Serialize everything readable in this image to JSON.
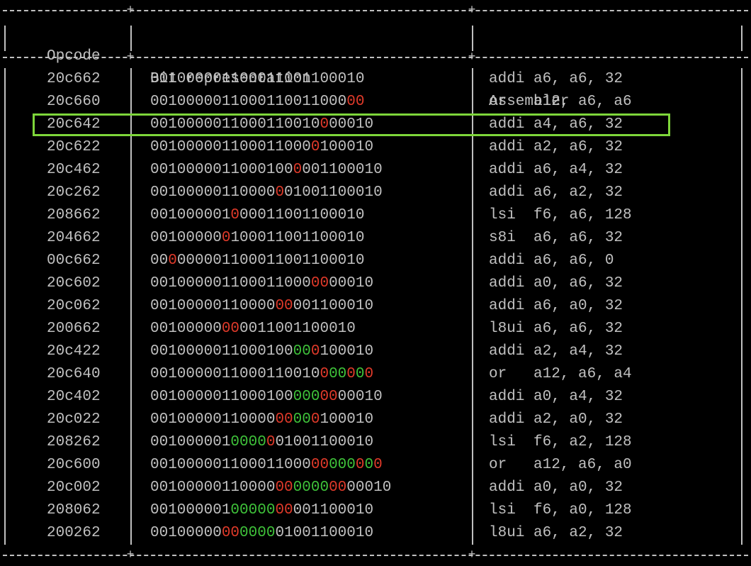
{
  "colors": {
    "background": "#000000",
    "text": "#c0c0c0",
    "changed_bit": "#e03a2a",
    "unchanged_marked_bit": "#3fc23a",
    "highlight": "#7ed63a"
  },
  "headers": {
    "opcode": "Opcode",
    "bits": "Bit representation",
    "assembler": "Assembler"
  },
  "rows": [
    {
      "opcode": "20c662",
      "bits": [
        [
          "001000001100011001100010",
          ""
        ]
      ],
      "asm": "addi a6, a6, 32"
    },
    {
      "opcode": "20c660",
      "bits": [
        [
          "0010000011000110011000",
          ""
        ],
        [
          "00",
          "r"
        ]
      ],
      "asm": "or   a12, a6, a6"
    },
    {
      "opcode": "20c642",
      "bits": [
        [
          "0010000011000110010",
          ""
        ],
        [
          "0",
          "r"
        ],
        [
          "00010",
          ""
        ]
      ],
      "asm": "addi a4, a6, 32",
      "highlighted": true
    },
    {
      "opcode": "20c622",
      "bits": [
        [
          "001000001100011000",
          ""
        ],
        [
          "0",
          "r"
        ],
        [
          "100010",
          ""
        ]
      ],
      "asm": "addi a2, a6, 32"
    },
    {
      "opcode": "20c462",
      "bits": [
        [
          "0010000011000100",
          ""
        ],
        [
          "0",
          "r"
        ],
        [
          "0",
          ""
        ],
        [
          "01100010",
          ""
        ]
      ],
      "asm": "addi a6, a4, 32"
    },
    {
      "opcode": "20c262",
      "bits": [
        [
          "00100000110000",
          ""
        ],
        [
          "0",
          "r"
        ],
        [
          "01001100010",
          ""
        ]
      ],
      "asm": "addi a6, a2, 32"
    },
    {
      "opcode": "208662",
      "bits": [
        [
          "001000001",
          ""
        ],
        [
          "0",
          "r"
        ],
        [
          "00011001100010",
          ""
        ]
      ],
      "asm": "lsi  f6, a6, 128"
    },
    {
      "opcode": "204662",
      "bits": [
        [
          "00100000",
          ""
        ],
        [
          "0",
          "r"
        ],
        [
          "100011001100010",
          ""
        ]
      ],
      "asm": "s8i  a6, a6, 32"
    },
    {
      "opcode": "00c662",
      "bits": [
        [
          "00",
          ""
        ],
        [
          "0",
          "r"
        ],
        [
          "000001100011001100010",
          ""
        ]
      ],
      "asm": "addi a6, a6, 0"
    },
    {
      "opcode": "20c602",
      "bits": [
        [
          "001000001100011000",
          ""
        ],
        [
          "00",
          "r"
        ],
        [
          "00010",
          ""
        ]
      ],
      "asm": "addi a0, a6, 32"
    },
    {
      "opcode": "20c062",
      "bits": [
        [
          "00100000110000",
          ""
        ],
        [
          "00",
          "r"
        ],
        [
          "001100010",
          ""
        ]
      ],
      "asm": "addi a6, a0, 32"
    },
    {
      "opcode": "200662",
      "bits": [
        [
          "00100000",
          ""
        ],
        [
          "00",
          "r"
        ],
        [
          "0011001100010",
          ""
        ]
      ],
      "asm": "l8ui a6, a6, 32"
    },
    {
      "opcode": "20c422",
      "bits": [
        [
          "0010000011000100",
          ""
        ],
        [
          "00",
          "g"
        ],
        [
          "0",
          "r"
        ],
        [
          "100010",
          ""
        ]
      ],
      "asm": "addi a2, a4, 32"
    },
    {
      "opcode": "20c640",
      "bits": [
        [
          "0010000011000110010",
          ""
        ],
        [
          "0",
          "r"
        ],
        [
          "00",
          "g"
        ],
        [
          "0",
          "r"
        ],
        [
          "0",
          "g"
        ],
        [
          "0",
          "r"
        ]
      ],
      "asm": "or   a12, a6, a4"
    },
    {
      "opcode": "20c402",
      "bits": [
        [
          "0010000011000100",
          ""
        ],
        [
          "000",
          "g"
        ],
        [
          "00",
          "r"
        ],
        [
          "00010",
          ""
        ]
      ],
      "asm": "addi a0, a4, 32"
    },
    {
      "opcode": "20c022",
      "bits": [
        [
          "00100000110000",
          ""
        ],
        [
          "00",
          "r"
        ],
        [
          "00",
          "g"
        ],
        [
          "0",
          "r"
        ],
        [
          "100010",
          ""
        ]
      ],
      "asm": "addi a2, a0, 32"
    },
    {
      "opcode": "208262",
      "bits": [
        [
          "001000001",
          ""
        ],
        [
          "0000",
          "g"
        ],
        [
          "0",
          "r"
        ],
        [
          "01001100010",
          ""
        ]
      ],
      "asm": "lsi  f6, a2, 128"
    },
    {
      "opcode": "20c600",
      "bits": [
        [
          "001000001100011000",
          ""
        ],
        [
          "00",
          "r"
        ],
        [
          "000",
          "g"
        ],
        [
          "0",
          "r"
        ],
        [
          "0",
          "g"
        ],
        [
          "0",
          "r"
        ]
      ],
      "asm": "or   a12, a6, a0"
    },
    {
      "opcode": "20c002",
      "bits": [
        [
          "00100000110000",
          ""
        ],
        [
          "00",
          "r"
        ],
        [
          "0000",
          "g"
        ],
        [
          "00",
          "r"
        ],
        [
          "00010",
          ""
        ]
      ],
      "asm": "addi a0, a0, 32"
    },
    {
      "opcode": "208062",
      "bits": [
        [
          "001000001",
          ""
        ],
        [
          "00000",
          "g"
        ],
        [
          "00",
          "r"
        ],
        [
          "001100010",
          ""
        ]
      ],
      "asm": "lsi  f6, a0, 128"
    },
    {
      "opcode": "200262",
      "bits": [
        [
          "00100000",
          ""
        ],
        [
          "00",
          "r"
        ],
        [
          "0000",
          "g"
        ],
        [
          "01001100010",
          ""
        ]
      ],
      "asm": "l8ui a6, a2, 32"
    }
  ]
}
